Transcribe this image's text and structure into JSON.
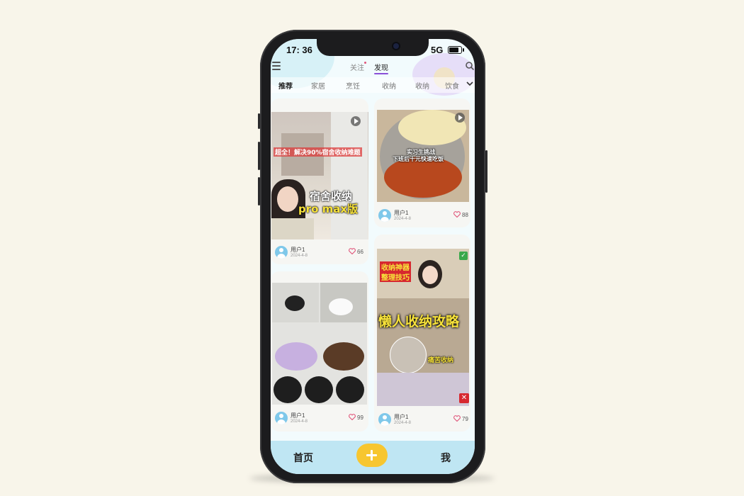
{
  "status_bar": {
    "time": "17: 36",
    "network": "5G",
    "battery_level": 0.8
  },
  "top_tabs": [
    {
      "label": "关注",
      "active": false
    },
    {
      "label": "发现",
      "active": true
    }
  ],
  "categories": [
    {
      "label": "推荐",
      "active": true
    },
    {
      "label": "家居",
      "active": false
    },
    {
      "label": "烹饪",
      "active": false
    },
    {
      "label": "收纳",
      "active": false
    },
    {
      "label": "收纳",
      "active": false
    },
    {
      "label": "饮食",
      "active": false
    }
  ],
  "posts": [
    {
      "user": "用户1",
      "date": "2024-4-8",
      "likes": "66",
      "overlay": {
        "line1": "超全！解决90%宿舍收纳难题",
        "line2": "宿舍收纳",
        "line3": "pro max版"
      }
    },
    {
      "user": "用户1",
      "date": "2024-4-8",
      "likes": "88",
      "overlay": {
        "line1": "实习生挑战",
        "line2": "下班后十元快速吃饭"
      }
    },
    {
      "user": "用户1",
      "date": "2024-4-8",
      "likes": "99",
      "overlay": {
        "line1": "",
        "line2": ""
      }
    },
    {
      "user": "用户1",
      "date": "2024-4-8",
      "likes": "79",
      "overlay": {
        "line1": "收纳神器",
        "line2": "整理技巧",
        "line3": "懒人收纳攻略",
        "line4": "痛苦收纳"
      }
    }
  ],
  "bottom_nav": {
    "home": "首页",
    "me": "我"
  },
  "colors": {
    "accent": "#8a4fd8",
    "plus": "#f7c62f",
    "bottom_bar": "#bfe6f3",
    "heart": "#e0557a"
  }
}
